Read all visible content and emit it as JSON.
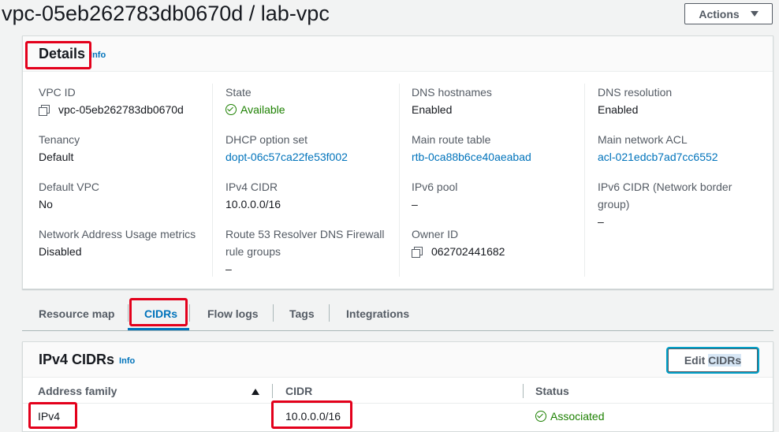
{
  "header": {
    "title": "vpc-05eb262783db0670d / lab-vpc",
    "actions_label": "Actions"
  },
  "details": {
    "title": "Details",
    "info": "Info",
    "columns": [
      [
        {
          "label": "VPC ID",
          "value": "vpc-05eb262783db0670d",
          "kind": "copy"
        },
        {
          "label": "Tenancy",
          "value": "Default",
          "kind": "text"
        },
        {
          "label": "Default VPC",
          "value": "No",
          "kind": "text"
        },
        {
          "label": "Network Address Usage metrics",
          "value": "Disabled",
          "kind": "text"
        }
      ],
      [
        {
          "label": "State",
          "value": "Available",
          "kind": "status"
        },
        {
          "label": "DHCP option set",
          "value": "dopt-06c57ca22fe53f002",
          "kind": "link"
        },
        {
          "label": "IPv4 CIDR",
          "value": "10.0.0.0/16",
          "kind": "text"
        },
        {
          "label": "Route 53 Resolver DNS Firewall rule groups",
          "value": "–",
          "kind": "text"
        }
      ],
      [
        {
          "label": "DNS hostnames",
          "value": "Enabled",
          "kind": "text"
        },
        {
          "label": "Main route table",
          "value": "rtb-0ca88b6ce40aeabad",
          "kind": "link"
        },
        {
          "label": "IPv6 pool",
          "value": "–",
          "kind": "text"
        },
        {
          "label": "Owner ID",
          "value": "062702441682",
          "kind": "copy"
        }
      ],
      [
        {
          "label": "DNS resolution",
          "value": "Enabled",
          "kind": "text"
        },
        {
          "label": "Main network ACL",
          "value": "acl-021edcb7ad7cc6552",
          "kind": "link"
        },
        {
          "label": "IPv6 CIDR (Network border group)",
          "value": "–",
          "kind": "text"
        }
      ]
    ]
  },
  "tabs": [
    "Resource map",
    "CIDRs",
    "Flow logs",
    "Tags",
    "Integrations"
  ],
  "cidrs": {
    "title": "IPv4 CIDRs",
    "info": "Info",
    "edit_label_prefix": "Edit ",
    "edit_label_selected": "CIDRs",
    "columns": [
      "Address family",
      "CIDR",
      "Status"
    ],
    "rows": [
      {
        "family": "IPv4",
        "cidr": "10.0.0.0/16",
        "status": "Associated"
      }
    ]
  }
}
